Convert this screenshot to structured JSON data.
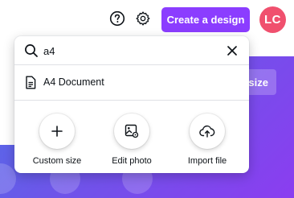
{
  "header": {
    "create_label": "Create a design",
    "avatar_initials": "LC",
    "help_icon": "question-circle-icon",
    "settings_icon": "gear-icon"
  },
  "background": {
    "resize_label": "size"
  },
  "search": {
    "value": "a4",
    "icon": "search-icon",
    "clear_icon": "close-icon"
  },
  "results": [
    {
      "label": "A4 Document",
      "icon": "document-icon"
    }
  ],
  "actions": [
    {
      "label": "Custom size",
      "icon": "plus-icon"
    },
    {
      "label": "Edit photo",
      "icon": "image-edit-icon"
    },
    {
      "label": "Import file",
      "icon": "cloud-upload-icon"
    }
  ],
  "colors": {
    "brand_purple": "#8b3dff",
    "avatar": "#f0506e",
    "hero_start": "#4f70e8",
    "hero_end": "#8b3df0"
  }
}
